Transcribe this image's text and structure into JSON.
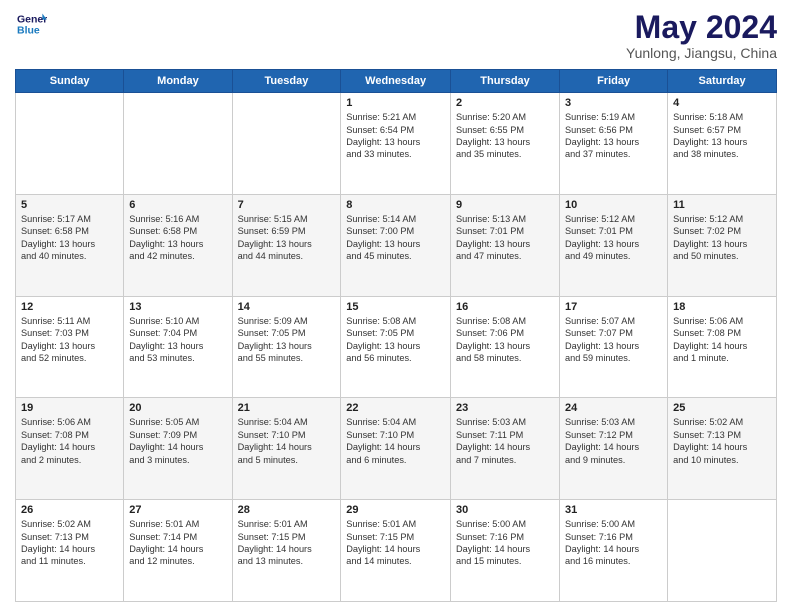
{
  "logo": {
    "line1": "General",
    "line2": "Blue"
  },
  "header": {
    "month": "May 2024",
    "location": "Yunlong, Jiangsu, China"
  },
  "weekdays": [
    "Sunday",
    "Monday",
    "Tuesday",
    "Wednesday",
    "Thursday",
    "Friday",
    "Saturday"
  ],
  "weeks": [
    [
      {
        "day": "",
        "info": ""
      },
      {
        "day": "",
        "info": ""
      },
      {
        "day": "",
        "info": ""
      },
      {
        "day": "1",
        "info": "Sunrise: 5:21 AM\nSunset: 6:54 PM\nDaylight: 13 hours\nand 33 minutes."
      },
      {
        "day": "2",
        "info": "Sunrise: 5:20 AM\nSunset: 6:55 PM\nDaylight: 13 hours\nand 35 minutes."
      },
      {
        "day": "3",
        "info": "Sunrise: 5:19 AM\nSunset: 6:56 PM\nDaylight: 13 hours\nand 37 minutes."
      },
      {
        "day": "4",
        "info": "Sunrise: 5:18 AM\nSunset: 6:57 PM\nDaylight: 13 hours\nand 38 minutes."
      }
    ],
    [
      {
        "day": "5",
        "info": "Sunrise: 5:17 AM\nSunset: 6:58 PM\nDaylight: 13 hours\nand 40 minutes."
      },
      {
        "day": "6",
        "info": "Sunrise: 5:16 AM\nSunset: 6:58 PM\nDaylight: 13 hours\nand 42 minutes."
      },
      {
        "day": "7",
        "info": "Sunrise: 5:15 AM\nSunset: 6:59 PM\nDaylight: 13 hours\nand 44 minutes."
      },
      {
        "day": "8",
        "info": "Sunrise: 5:14 AM\nSunset: 7:00 PM\nDaylight: 13 hours\nand 45 minutes."
      },
      {
        "day": "9",
        "info": "Sunrise: 5:13 AM\nSunset: 7:01 PM\nDaylight: 13 hours\nand 47 minutes."
      },
      {
        "day": "10",
        "info": "Sunrise: 5:12 AM\nSunset: 7:01 PM\nDaylight: 13 hours\nand 49 minutes."
      },
      {
        "day": "11",
        "info": "Sunrise: 5:12 AM\nSunset: 7:02 PM\nDaylight: 13 hours\nand 50 minutes."
      }
    ],
    [
      {
        "day": "12",
        "info": "Sunrise: 5:11 AM\nSunset: 7:03 PM\nDaylight: 13 hours\nand 52 minutes."
      },
      {
        "day": "13",
        "info": "Sunrise: 5:10 AM\nSunset: 7:04 PM\nDaylight: 13 hours\nand 53 minutes."
      },
      {
        "day": "14",
        "info": "Sunrise: 5:09 AM\nSunset: 7:05 PM\nDaylight: 13 hours\nand 55 minutes."
      },
      {
        "day": "15",
        "info": "Sunrise: 5:08 AM\nSunset: 7:05 PM\nDaylight: 13 hours\nand 56 minutes."
      },
      {
        "day": "16",
        "info": "Sunrise: 5:08 AM\nSunset: 7:06 PM\nDaylight: 13 hours\nand 58 minutes."
      },
      {
        "day": "17",
        "info": "Sunrise: 5:07 AM\nSunset: 7:07 PM\nDaylight: 13 hours\nand 59 minutes."
      },
      {
        "day": "18",
        "info": "Sunrise: 5:06 AM\nSunset: 7:08 PM\nDaylight: 14 hours\nand 1 minute."
      }
    ],
    [
      {
        "day": "19",
        "info": "Sunrise: 5:06 AM\nSunset: 7:08 PM\nDaylight: 14 hours\nand 2 minutes."
      },
      {
        "day": "20",
        "info": "Sunrise: 5:05 AM\nSunset: 7:09 PM\nDaylight: 14 hours\nand 3 minutes."
      },
      {
        "day": "21",
        "info": "Sunrise: 5:04 AM\nSunset: 7:10 PM\nDaylight: 14 hours\nand 5 minutes."
      },
      {
        "day": "22",
        "info": "Sunrise: 5:04 AM\nSunset: 7:10 PM\nDaylight: 14 hours\nand 6 minutes."
      },
      {
        "day": "23",
        "info": "Sunrise: 5:03 AM\nSunset: 7:11 PM\nDaylight: 14 hours\nand 7 minutes."
      },
      {
        "day": "24",
        "info": "Sunrise: 5:03 AM\nSunset: 7:12 PM\nDaylight: 14 hours\nand 9 minutes."
      },
      {
        "day": "25",
        "info": "Sunrise: 5:02 AM\nSunset: 7:13 PM\nDaylight: 14 hours\nand 10 minutes."
      }
    ],
    [
      {
        "day": "26",
        "info": "Sunrise: 5:02 AM\nSunset: 7:13 PM\nDaylight: 14 hours\nand 11 minutes."
      },
      {
        "day": "27",
        "info": "Sunrise: 5:01 AM\nSunset: 7:14 PM\nDaylight: 14 hours\nand 12 minutes."
      },
      {
        "day": "28",
        "info": "Sunrise: 5:01 AM\nSunset: 7:15 PM\nDaylight: 14 hours\nand 13 minutes."
      },
      {
        "day": "29",
        "info": "Sunrise: 5:01 AM\nSunset: 7:15 PM\nDaylight: 14 hours\nand 14 minutes."
      },
      {
        "day": "30",
        "info": "Sunrise: 5:00 AM\nSunset: 7:16 PM\nDaylight: 14 hours\nand 15 minutes."
      },
      {
        "day": "31",
        "info": "Sunrise: 5:00 AM\nSunset: 7:16 PM\nDaylight: 14 hours\nand 16 minutes."
      },
      {
        "day": "",
        "info": ""
      }
    ]
  ]
}
